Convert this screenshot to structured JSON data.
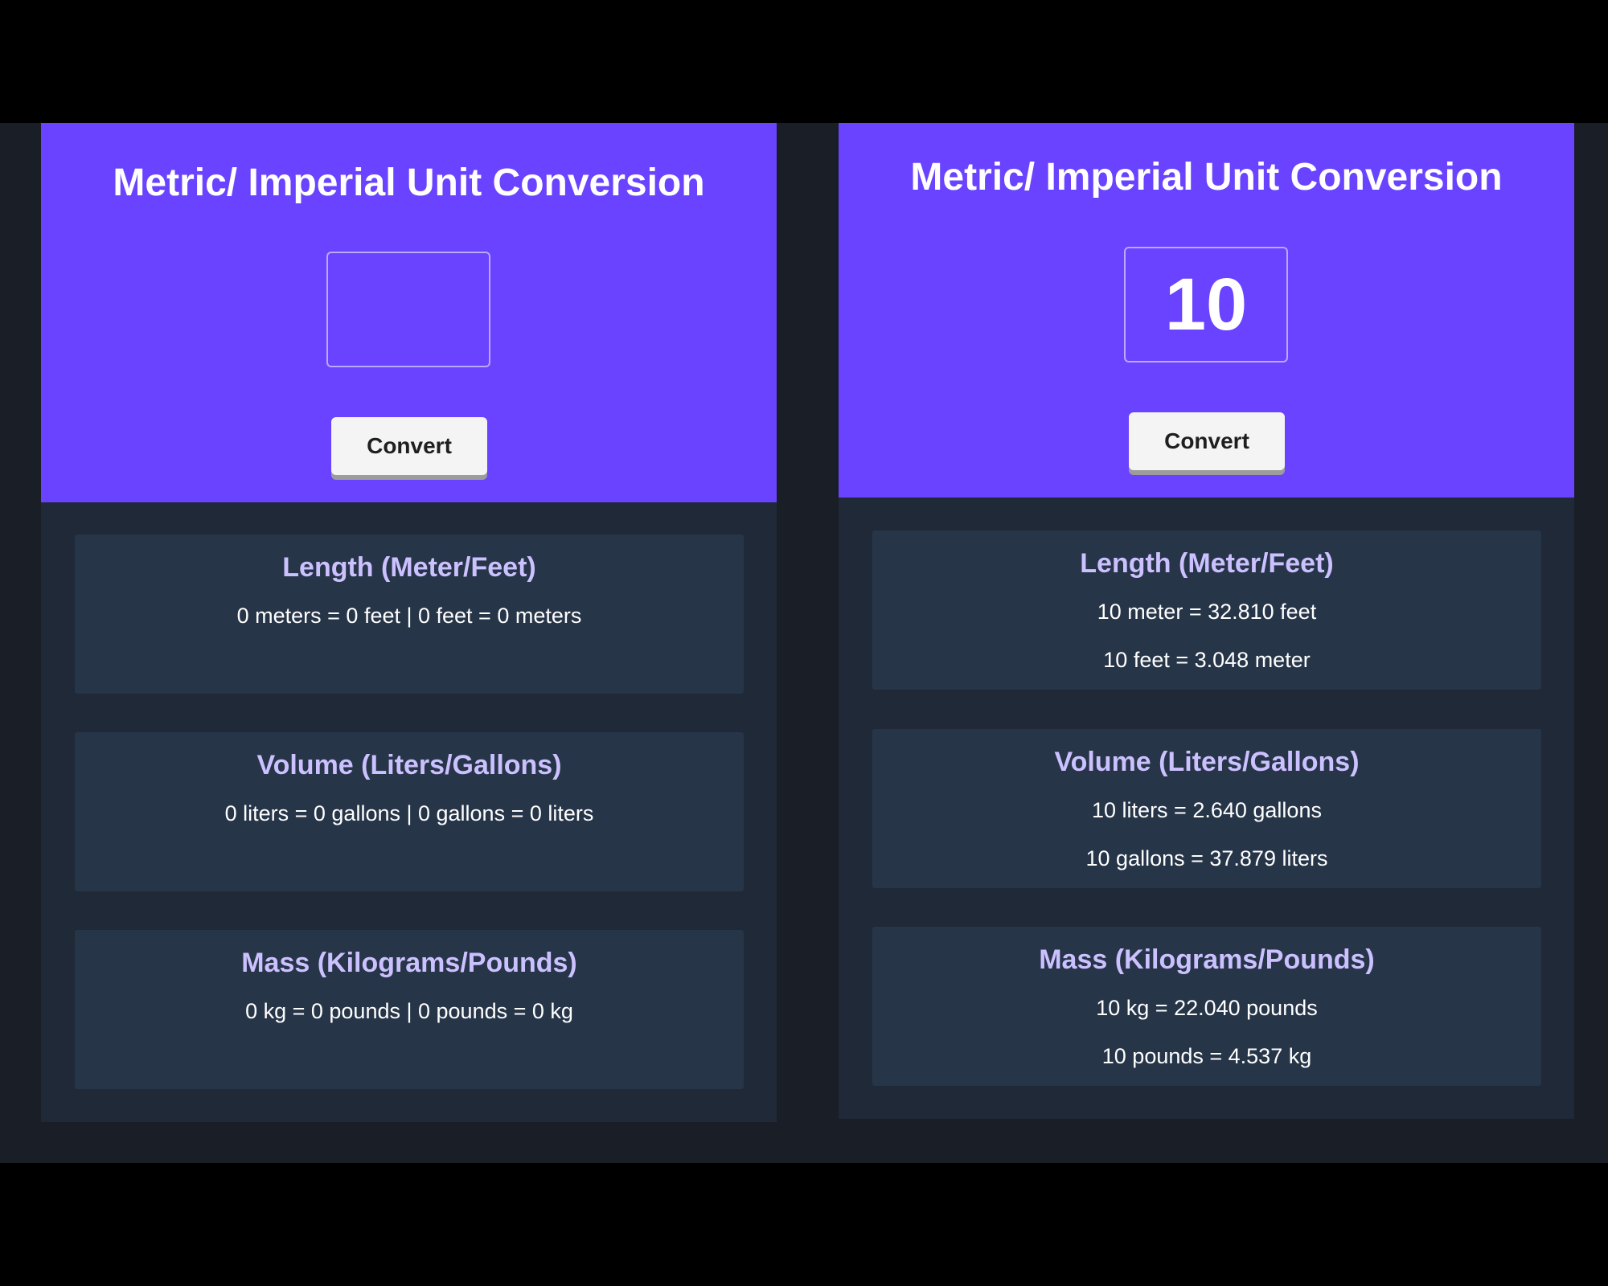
{
  "colors": {
    "background": "#000000",
    "stage": "#1a1e27",
    "panel": "#1f2937",
    "header": "#6943ff",
    "card": "#273549",
    "card_title": "#ccc1ff",
    "button": "#f4f4f4"
  },
  "left_panel": {
    "title": "Metric/ Imperial Unit Conversion",
    "input_value": "",
    "convert_label": "Convert",
    "cards": [
      {
        "title": "Length (Meter/Feet)",
        "line": "0 meters = 0 feet | 0 feet = 0 meters"
      },
      {
        "title": "Volume (Liters/Gallons)",
        "line": "0 liters = 0 gallons | 0 gallons = 0 liters"
      },
      {
        "title": "Mass (Kilograms/Pounds)",
        "line": "0 kg = 0 pounds | 0 pounds = 0 kg"
      }
    ]
  },
  "right_panel": {
    "title": "Metric/ Imperial Unit Conversion",
    "input_value": "10",
    "convert_label": "Convert",
    "cards": [
      {
        "title": "Length (Meter/Feet)",
        "line1": "10 meter = 32.810 feet",
        "line2": "10 feet = 3.048 meter"
      },
      {
        "title": "Volume (Liters/Gallons)",
        "line1": "10 liters = 2.640 gallons",
        "line2": "10 gallons = 37.879 liters"
      },
      {
        "title": "Mass (Kilograms/Pounds)",
        "line1": "10 kg = 22.040 pounds",
        "line2": "10 pounds = 4.537 kg"
      }
    ]
  }
}
